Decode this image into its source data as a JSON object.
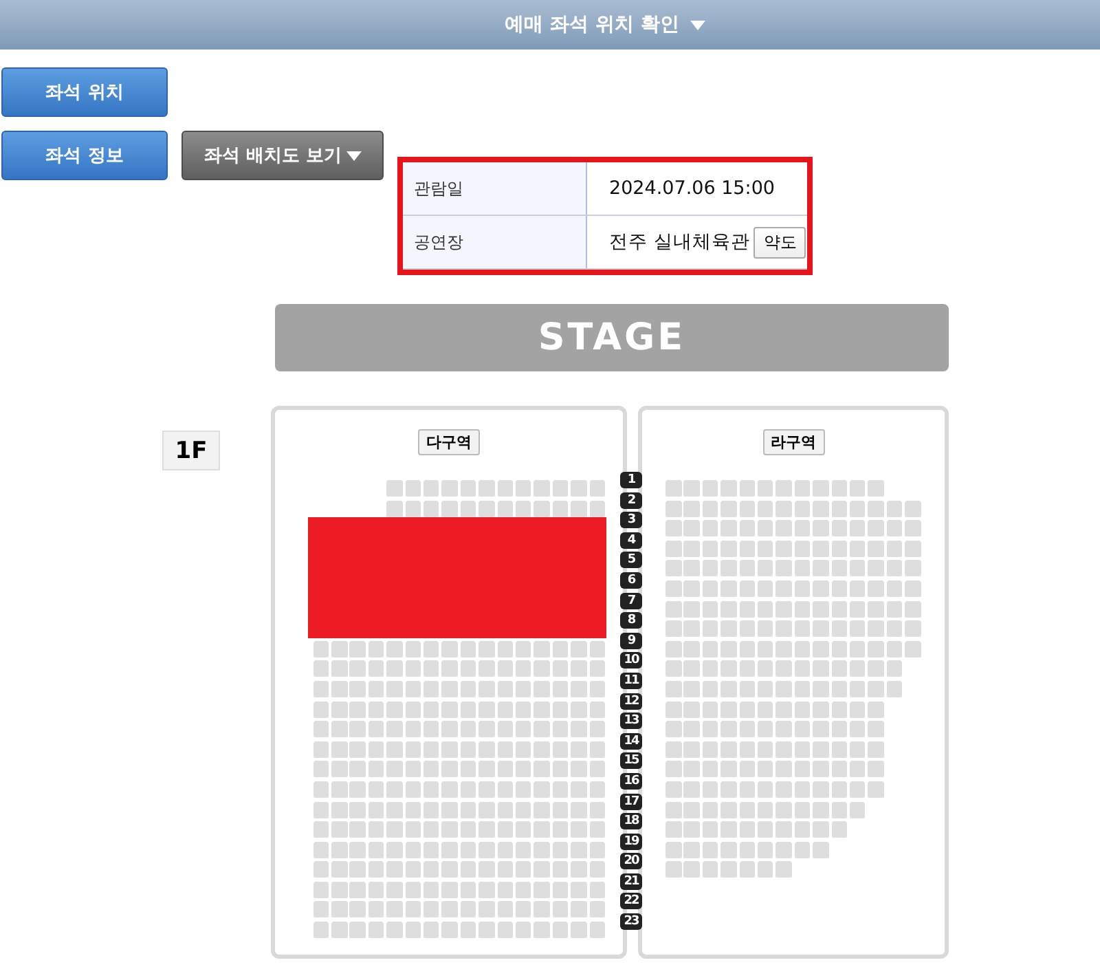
{
  "header": {
    "title": "예매 좌석 위치 확인"
  },
  "buttons": [
    {
      "label": "좌석 위치",
      "kind": "primary"
    },
    {
      "label": "좌석 정보",
      "kind": "primary"
    },
    {
      "label": "좌석 배치도 보기",
      "kind": "dropdown"
    }
  ],
  "info": [
    {
      "label": "관람일",
      "value": "2024.07.06 15:00"
    },
    {
      "label": "공연장",
      "value": "전주 실내체육관",
      "action": "약도"
    }
  ],
  "stage": "STAGE",
  "floor": "1F",
  "sections": [
    {
      "label": "다구역"
    },
    {
      "label": "라구역"
    }
  ],
  "row_numbers": [
    "1",
    "2",
    "3",
    "4",
    "5",
    "6",
    "7",
    "8",
    "9",
    "10",
    "11",
    "12",
    "13",
    "14",
    "15",
    "16",
    "17",
    "18",
    "19",
    "20",
    "21",
    "22",
    "23"
  ]
}
